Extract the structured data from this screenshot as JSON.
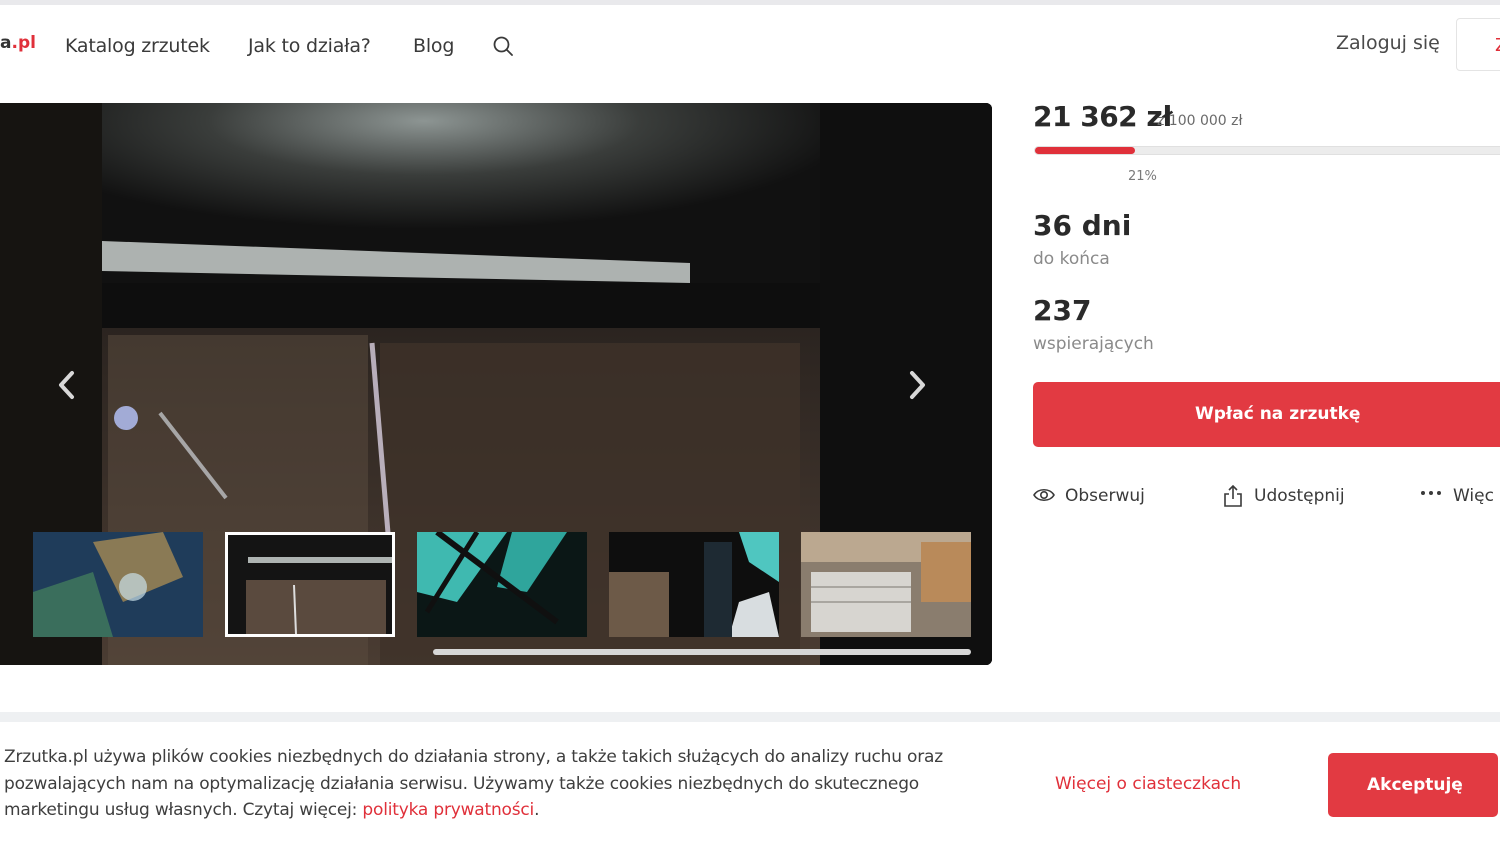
{
  "header": {
    "logo_text": "a",
    "logo_suffix": ".pl",
    "nav": [
      "Katalog zrzutek",
      "Jak to działa?",
      "Blog"
    ],
    "login": "Zaloguj się",
    "cta_partial": "Z"
  },
  "icons": {
    "search": "search-icon",
    "prev": "chevron-left-icon",
    "next": "chevron-right-icon",
    "observe": "eye-icon",
    "share": "share-icon",
    "more": "ellipsis-icon"
  },
  "gallery": {
    "thumbnails_count": 5,
    "active_thumbnail": 2
  },
  "fundraiser": {
    "amount": "21 362 zł",
    "goal": "z 100 000 zł",
    "progress": 0.21,
    "percent_label": "21%",
    "days_value": "36 dni",
    "days_label": "do końca",
    "supporters_value": "237",
    "supporters_label": "wspierających",
    "donate_button": "Wpłać na zrzutkę",
    "actions": {
      "observe": "Obserwuj",
      "share": "Udostępnij",
      "more": "Więc"
    }
  },
  "colors": {
    "accent": "#e23a42",
    "link": "#e0303a"
  },
  "cookie_banner": {
    "text": "Zrzutka.pl używa plików cookies niezbędnych do działania strony, a także takich służących do analizy ruchu oraz pozwalających nam na optymalizację działania serwisu. Używamy także cookies niezbędnych do skutecznego marketingu usług własnych. Czytaj więcej: ",
    "policy_link": "polityka prywatności",
    "policy_suffix": ".",
    "more_link": "Więcej o ciasteczkach",
    "accept_button": "Akceptuję"
  }
}
